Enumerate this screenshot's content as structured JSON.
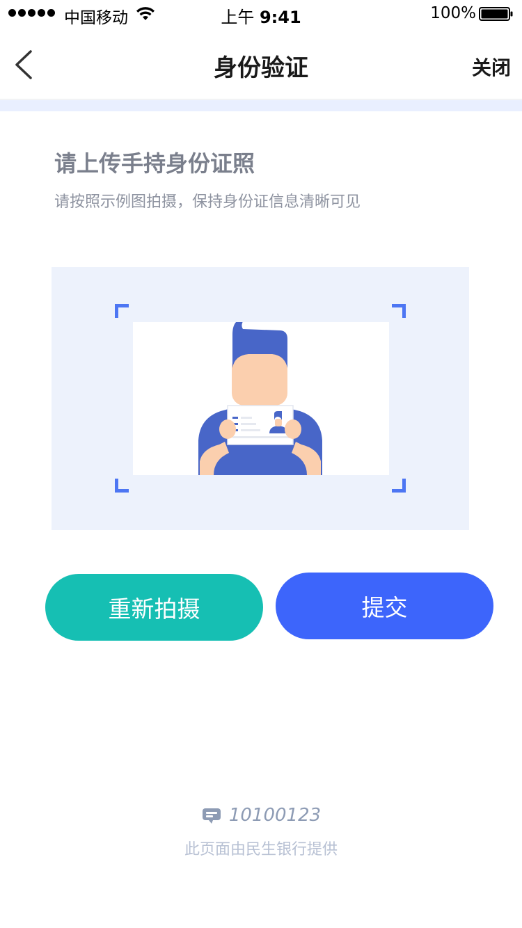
{
  "status_bar": {
    "carrier": "中国移动",
    "time_prefix": "上午",
    "time": "9:41",
    "battery_percent": "100%",
    "icons": [
      "signal-dots-icon",
      "wifi-icon",
      "battery-icon"
    ]
  },
  "nav": {
    "back_icon": "chevron-left-icon",
    "title": "身份验证",
    "close_label": "关闭"
  },
  "content": {
    "heading": "请上传手持身份证照",
    "subheading": "请按照示例图拍摄，保持身份证信息清晰可见",
    "sample_image": "person-holding-id-card-illustration"
  },
  "actions": {
    "retake_label": "重新拍摄",
    "submit_label": "提交"
  },
  "footer": {
    "hotline_icon": "customer-service-icon",
    "hotline": "10100123",
    "note": "此页面由民生银行提供"
  },
  "colors": {
    "accent_blue": "#3d65fb",
    "teal": "#16bfb3",
    "frame_bg": "#edf2fc",
    "corner": "#4d76f3",
    "figure_blue": "#4866c8",
    "skin": "#fbcfae"
  }
}
